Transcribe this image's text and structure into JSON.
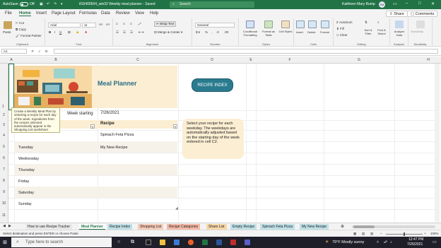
{
  "titlebar": {
    "autosave_label": "AutoSave",
    "autosave_state": "Off",
    "filename": "tf16400504_win32 Weekly meal planner  -  Saved",
    "search_placeholder": "Search",
    "user_name": "Kathleen Mary Bump",
    "user_initials": "KM",
    "bg_color": "#217346"
  },
  "menu": {
    "tabs": [
      "File",
      "Home",
      "Insert",
      "Page Layout",
      "Formulas",
      "Data",
      "Review",
      "View",
      "Help"
    ],
    "active_tab": "Home",
    "share_label": "Share",
    "comments_label": "Comments"
  },
  "ribbon": {
    "clipboard": {
      "paste": "Paste",
      "cut": "Cut",
      "copy": "Copy",
      "format_painter": "Format Painter",
      "label": "Clipboard"
    },
    "font": {
      "name": "Arial",
      "size": "11",
      "label": "Font"
    },
    "alignment": {
      "wrap": "Wrap Text",
      "merge": "Merge & Center",
      "label": "Alignment"
    },
    "number": {
      "format": "General",
      "label": "Number"
    },
    "styles": {
      "conditional": "Conditional Formatting",
      "format_table": "Format as Table",
      "cell_styles": "Cell Styles",
      "label": "Styles"
    },
    "cells": {
      "insert": "Insert",
      "delete": "Delete",
      "format": "Format",
      "label": "Cells"
    },
    "editing": {
      "autosum": "AutoSum",
      "fill": "Fill",
      "clear": "Clear",
      "sort": "Sort & Filter",
      "find": "Find & Select",
      "label": "Editing"
    },
    "analysis": {
      "analyze": "Analyze Data",
      "label": "Analysis"
    },
    "sensitivity": {
      "btn": "Sensitivity",
      "label": "Sensitivity"
    }
  },
  "formula_bar": {
    "name_box": "A1",
    "fx": "fx",
    "content": ""
  },
  "columns": [
    "A",
    "B",
    "C",
    "D",
    "E",
    "F",
    "G",
    "H"
  ],
  "rows": [
    "1",
    "2",
    "3",
    "4",
    "5",
    "6",
    "7",
    "8",
    "9",
    "10",
    "11"
  ],
  "planner": {
    "title": "Meal Planner",
    "week_label": "Week starting",
    "week_date": "7/26/2021",
    "recipe_header": "Recipe",
    "days": [
      "Tuesday",
      "Wednesday",
      "Thursday",
      "Friday",
      "Saturday",
      "Sunday"
    ],
    "recipes": [
      "Spinach Feta Pizza",
      "My New Recipe"
    ],
    "recipe_index_button": "RECIPE INDEX",
    "note": "Select your recipe for each weekday. The weekdays are automatically adjusted based on the starting day of the week entered in cell C2.",
    "tooltip": "Create a Weekly Meal Plan by selecting a recipe for each day of the week. Ingredients from the recipes selected automatically appear in the Shopping List worksheet"
  },
  "sheet_tabs": [
    {
      "label": "How to use Recipe Tracker",
      "color": "#e9e9e9",
      "active": false
    },
    {
      "label": "Meal Planner",
      "color": "#ffffff",
      "active": true
    },
    {
      "label": "Recipe Index",
      "color": "#bfe0e7",
      "active": false
    },
    {
      "label": "Shopping List",
      "color": "#f7cbb8",
      "active": false
    },
    {
      "label": "Recipe Categories",
      "color": "#f4b9a6",
      "active": false
    },
    {
      "label": "Share List",
      "color": "#f7d7a7",
      "active": false
    },
    {
      "label": "Empty Recipe",
      "color": "#bfe0e7",
      "active": false
    },
    {
      "label": "Spinach Feta Pizza",
      "color": "#bfe0e7",
      "active": false
    },
    {
      "label": "My New Recipe",
      "color": "#bfe0e7",
      "active": false
    }
  ],
  "status": {
    "message": "Select destination and press ENTER or choose Paste",
    "zoom": "100%"
  },
  "taskbar": {
    "search_placeholder": "Type here to search",
    "weather": "79°F  Mostly sunny",
    "time": "12:47 PM",
    "date": "7/26/2021"
  }
}
